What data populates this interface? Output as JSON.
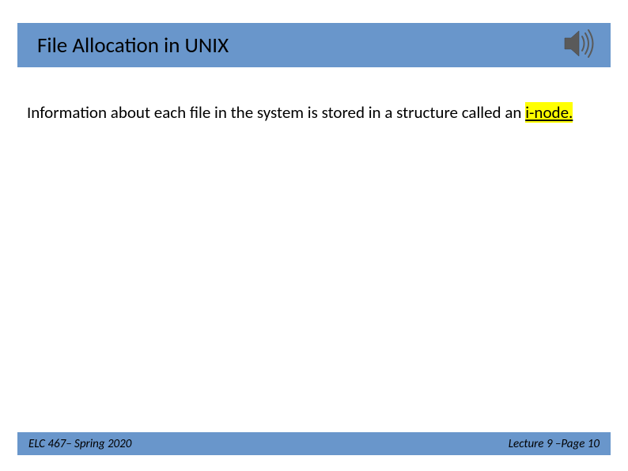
{
  "header": {
    "title": "File Allocation in UNIX"
  },
  "body": {
    "text_before": "Information about each file in the system is stored in a structure called an ",
    "highlighted": "i-node.",
    "text_after": ""
  },
  "footer": {
    "left": "ELC 467– Spring 2020",
    "right": "Lecture 9 –Page 10"
  },
  "icons": {
    "speaker": "speaker-icon"
  }
}
